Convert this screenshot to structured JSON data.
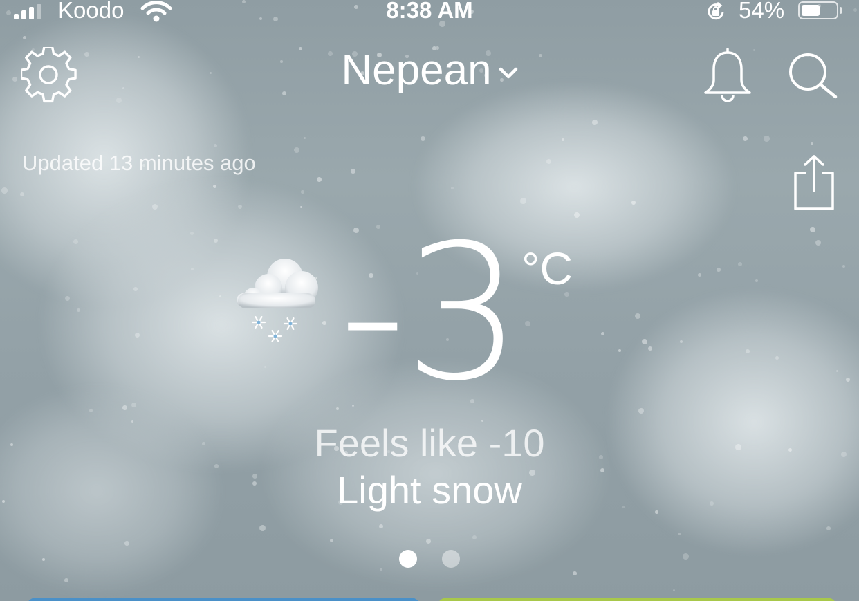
{
  "status_bar": {
    "carrier": "Koodo",
    "time": "8:38 AM",
    "battery_percent": "54%",
    "battery_level": 0.54,
    "icons": [
      "signal-icon",
      "wifi-icon",
      "rotation-lock-icon",
      "battery-icon"
    ]
  },
  "header": {
    "location": "Nepean",
    "icons": [
      "gear-icon",
      "chevron-down-icon",
      "bell-icon",
      "search-icon",
      "share-icon"
    ]
  },
  "updated_text": "Updated 13 minutes ago",
  "current": {
    "temperature": "-3",
    "unit": "°C",
    "feels_like": "Feels like -10",
    "condition": "Light snow",
    "condition_icon": "cloud-snow-icon"
  },
  "pager": {
    "pages": 2,
    "active_index": 0
  },
  "colors": {
    "background": "#93a1a7",
    "text": "#ffffff",
    "card_left": "#4a90c8",
    "card_right": "#a8c84a"
  }
}
